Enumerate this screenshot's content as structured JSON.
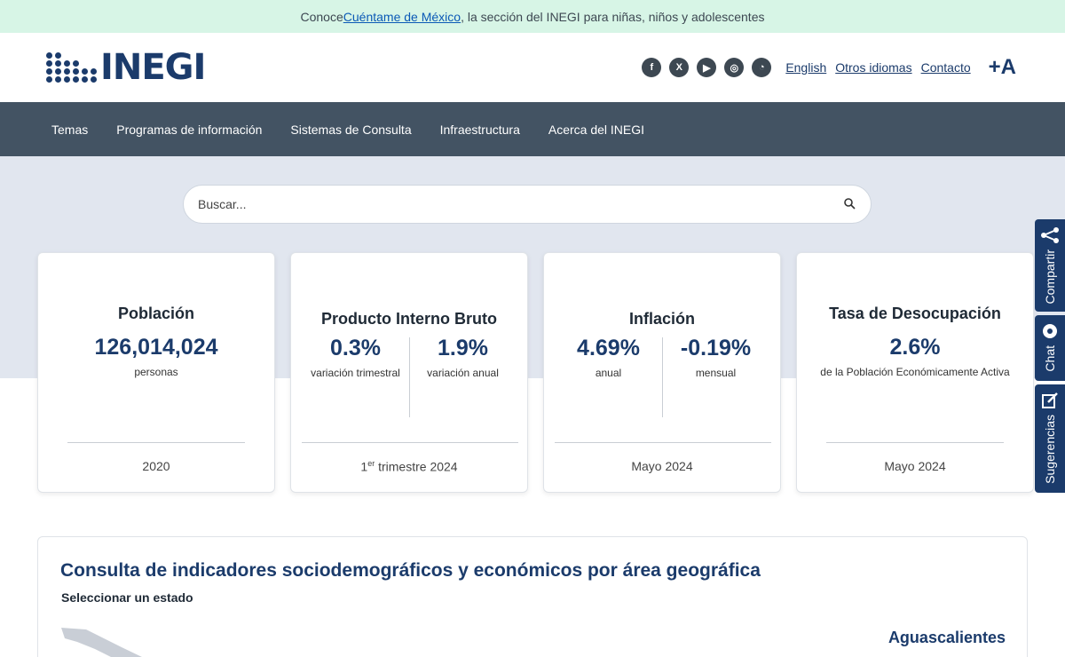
{
  "banner": {
    "prefix": "Conoce ",
    "link": "Cuéntame de México",
    "suffix": ", la sección del INEGI para niñas, niños y adolescentes"
  },
  "header": {
    "logo_text": "INEGI",
    "social_icons": [
      "facebook-icon",
      "x-icon",
      "youtube-icon",
      "instagram-icon",
      "rss-icon"
    ],
    "links": {
      "english": "English",
      "otros_idiomas": "Otros idiomas",
      "contacto": "Contacto"
    },
    "font_size_label": "+A"
  },
  "nav": {
    "items": [
      "Temas",
      "Programas de información",
      "Sistemas de Consulta",
      "Infraestructura",
      "Acerca del INEGI"
    ]
  },
  "search": {
    "placeholder": "Buscar..."
  },
  "cards": {
    "poblacion": {
      "title": "Población",
      "value": "126,014,024",
      "unit": "personas",
      "footer": "2020"
    },
    "pib": {
      "title": "Producto Interno Bruto",
      "v1": "0.3%",
      "l1": "variación trimestral",
      "v2": "1.9%",
      "l2": "variación anual",
      "footer_num": "1",
      "footer_sup": "er",
      "footer_rest": " trimestre 2024"
    },
    "inflacion": {
      "title": "Inflación",
      "v1": "4.69%",
      "l1": "anual",
      "v2": "-0.19%",
      "l2": "mensual",
      "footer": "Mayo 2024"
    },
    "desocupacion": {
      "title": "Tasa de Desocupación",
      "value": "2.6%",
      "unit": "de la Población Económicamente Activa",
      "footer": "Mayo 2024"
    }
  },
  "side_tabs": {
    "compartir": "Compartir",
    "chat": "Chat",
    "sugerencias": "Sugerencias"
  },
  "panel": {
    "title": "Consulta de indicadores sociodemográficos y económicos por área geográfica",
    "subtitle": "Seleccionar un estado",
    "state": "Aguascalientes"
  },
  "colors": {
    "navy": "#1b3b6b",
    "nav_bg": "#435363",
    "banner_bg": "#d7f5e6",
    "hero_bg": "#e1e6ef"
  }
}
